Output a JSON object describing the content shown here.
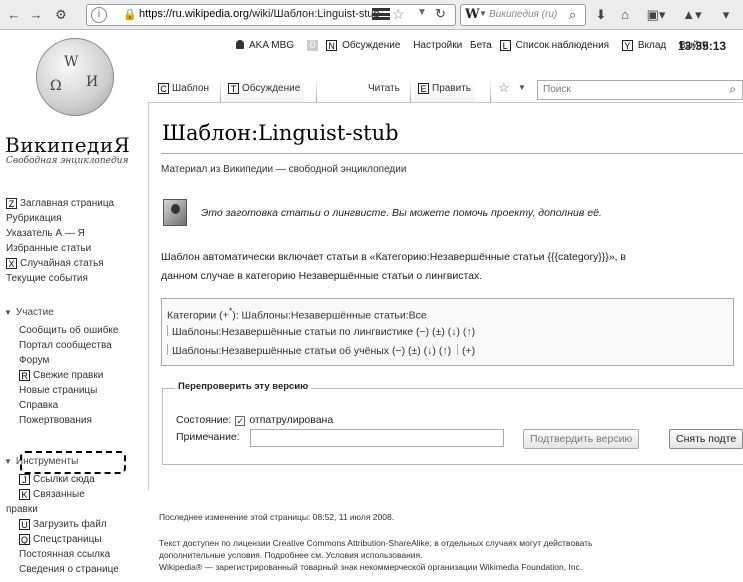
{
  "browser": {
    "url_host": "https://ru.wikipedia.org",
    "url_path": "/wiki/Шаблон:Linguist-stub",
    "search_engine_placeholder": "Википедия (ru)",
    "info_icon": "i"
  },
  "personal": {
    "user": "AKA MBG",
    "notice_count": "0",
    "talk": "Обсуждение",
    "settings": "Настройки",
    "beta": "Бета",
    "watchlist": "Список наблюдения",
    "contributions": "Вклад",
    "logout": "Выйти",
    "time": "13:35:13",
    "talk_key": "N",
    "watchlist_key": "L",
    "contributions_key": "Y"
  },
  "tabs": {
    "template": "Шаблон",
    "template_key": "C",
    "discussion": "Обсуждение",
    "discussion_key": "T",
    "read": "Читать",
    "edit": "Править",
    "edit_key": "E",
    "search_placeholder": "Поиск"
  },
  "logo": {
    "wordmark": "ВикипедиЯ",
    "tagline": "Свободная энциклопедия"
  },
  "sidebar": {
    "main": [
      {
        "key": "Z",
        "label": "Заглавная страница"
      },
      {
        "key": "",
        "label": "Рубрикация"
      },
      {
        "key": "",
        "label": "Указатель А — Я"
      },
      {
        "key": "",
        "label": "Избранные статьи"
      },
      {
        "key": "X",
        "label": "Случайная статья"
      },
      {
        "key": "",
        "label": "Текущие события"
      }
    ],
    "participation_head": "Участие",
    "participation": [
      {
        "key": "",
        "label": "Сообщить об ошибке"
      },
      {
        "key": "",
        "label": "Портал сообщества"
      },
      {
        "key": "",
        "label": "Форум"
      },
      {
        "key": "R",
        "label": "Свежие правки"
      },
      {
        "key": "",
        "label": "Новые страницы"
      },
      {
        "key": "",
        "label": "Справка"
      },
      {
        "key": "",
        "label": "Пожертвования"
      }
    ],
    "tools_head": "Инструменты",
    "tools": [
      {
        "key": "J",
        "label": "Ссылки сюда"
      },
      {
        "key": "K",
        "label": "Связанные"
      },
      {
        "key": "",
        "label": "правки"
      },
      {
        "key": "U",
        "label": "Загрузить файл"
      },
      {
        "key": "Q",
        "label": "Спецстраницы"
      },
      {
        "key": "",
        "label": "Постоянная ссылка"
      },
      {
        "key": "",
        "label": "Сведения о странице"
      }
    ]
  },
  "page": {
    "title": "Шаблон:Linguist-stub",
    "site_sub": "Материал из Википедии — свободной энциклопедии",
    "stub_text": "Это заготовка статьи о лингвисте. Вы можете помочь проекту, дополнив её.",
    "para_line1": "Шаблон автоматически включает статьи в «Категорию:Незавершённые статьи {{{category}}}», в",
    "para_line2": "данном случае в категорию Незавершённые статьи о лингвистах.",
    "cat_row1_prefix": "Категории (+",
    "cat_row1_sup": "*",
    "cat_row1_rest": "):  Шаблоны:Незавершённые статьи:Все",
    "cat_row2": "Шаблоны:Незавершённые статьи по лингвистике (−) (±) (↓) (↑)",
    "cat_row3": "Шаблоны:Незавершённые статьи об учёных (−) (±) (↓) (↑)",
    "cat_row3_plus": "(+)"
  },
  "review": {
    "legend": "Перепроверить эту версию",
    "state_label": "Состояние:",
    "state_value": "отпатрулирована",
    "note_label": "Примечание:",
    "note_value": "",
    "confirm_button": "Подтвердить версию",
    "remove_button": "Снять подте"
  },
  "footer": {
    "last_modified": "Последнее изменение этой страницы: 08:52, 11 июля 2008.",
    "license_line1": "Текст доступен по лицензии Creative Commons Attribution-ShareAlike; в отдельных случаях могут действовать",
    "license_line2": "дополнительные условия. Подробнее см. Условия использования.",
    "trademark": "Wikipedia® — зарегистрированный товарный знак некоммерческой организации Wikimedia Foundation, Inc."
  }
}
